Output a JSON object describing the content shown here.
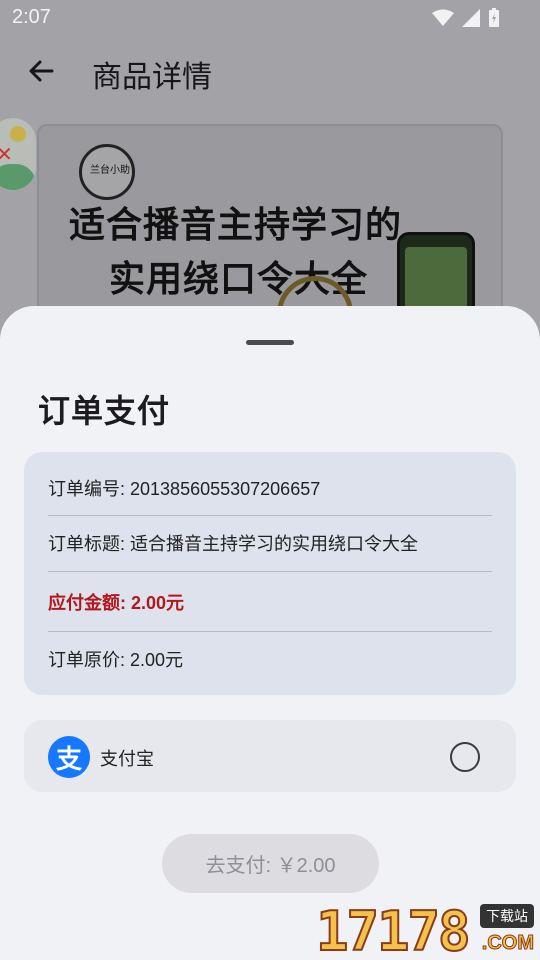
{
  "status_bar": {
    "time": "2:07"
  },
  "app_bar": {
    "title": "商品详情"
  },
  "product_image": {
    "logo_text": "兰台小助",
    "headline_line1": "适合播音主持学习的",
    "headline_line2": "实用绕口令大全"
  },
  "sheet": {
    "title": "订单支付",
    "order": {
      "number_label": "订单编号: ",
      "number_value": "2013856055307206657",
      "title_label": "订单标题: ",
      "title_value": "适合播音主持学习的实用绕口令大全",
      "amount_label": "应付金额: ",
      "amount_value": "2.00元",
      "original_label": "订单原价: ",
      "original_value": "2.00元"
    },
    "payment_method": {
      "name": "支付宝",
      "icon_glyph": "支",
      "selected": false
    },
    "pay_button_label": "去支付: ￥2.00"
  },
  "colors": {
    "amount_red": "#b3171e",
    "alipay_blue": "#1677ff",
    "sheet_bg": "#f1f2f6",
    "card_bg": "#dde2ec"
  },
  "watermark": {
    "number": "17178",
    "badge": "下载站",
    "domain": ".COM"
  }
}
